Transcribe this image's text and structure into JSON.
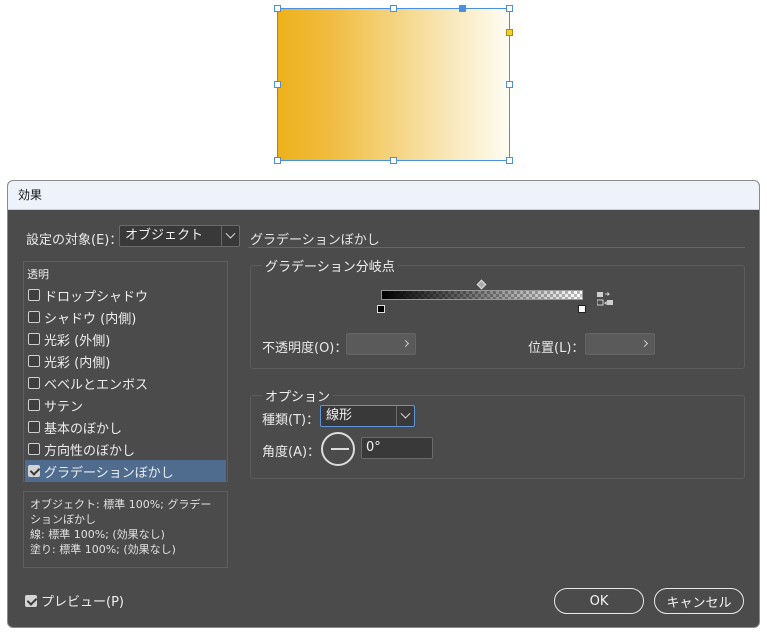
{
  "dialog": {
    "title": "効果",
    "settings_for_label": "設定の対象(E)：",
    "settings_for_value": "オブジェクト",
    "effect_heading": "グラデーションぼかし"
  },
  "effects_list": {
    "header": "透明",
    "items": [
      {
        "label": "ドロップシャドウ",
        "checked": false,
        "selected": false
      },
      {
        "label": "シャドウ (内側)",
        "checked": false,
        "selected": false
      },
      {
        "label": "光彩 (外側)",
        "checked": false,
        "selected": false
      },
      {
        "label": "光彩 (内側)",
        "checked": false,
        "selected": false
      },
      {
        "label": "ベベルとエンボス",
        "checked": false,
        "selected": false
      },
      {
        "label": "サテン",
        "checked": false,
        "selected": false
      },
      {
        "label": "基本のぼかし",
        "checked": false,
        "selected": false
      },
      {
        "label": "方向性のぼかし",
        "checked": false,
        "selected": false
      },
      {
        "label": "グラデーションぼかし",
        "checked": true,
        "selected": true
      }
    ]
  },
  "summary": {
    "line1": "オブジェクト: 標準 100%; グラデーションぼかし",
    "line2": "線: 標準 100%; (効果なし)",
    "line3": "塗り: 標準 100%; (効果なし)"
  },
  "gradient_stops": {
    "title": "グラデーション分岐点",
    "opacity_label": "不透明度(O)：",
    "opacity_value": "",
    "position_label": "位置(L)：",
    "position_value": ""
  },
  "options": {
    "title": "オプション",
    "type_label": "種類(T)：",
    "type_value": "線形",
    "angle_label": "角度(A)：",
    "angle_value": "0°"
  },
  "preview": {
    "label": "プレビュー(P)",
    "checked": true
  },
  "buttons": {
    "ok": "OK",
    "cancel": "キャンセル"
  },
  "colors": {
    "object_fill_start": "#eeb11a",
    "object_fill_end": "#fefcf3",
    "selection": "#4a8fe0",
    "dialog_bg": "#4b4b4b",
    "list_selected": "#4f6c8f"
  }
}
